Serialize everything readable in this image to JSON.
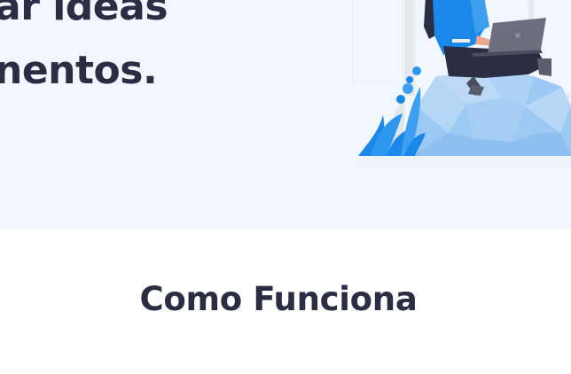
{
  "hero": {
    "heading_line1": "ar ideas",
    "heading_line2": "nentos."
  },
  "how_it_works": {
    "title": "Como Funciona"
  },
  "colors": {
    "hero_background": "#f1f7ff",
    "heading_text": "#2b2d42",
    "illustration_blue": "#1a88e8",
    "illustration_light_blue": "#9cc9f3"
  },
  "icons": [
    "person-with-laptop-illustration"
  ]
}
